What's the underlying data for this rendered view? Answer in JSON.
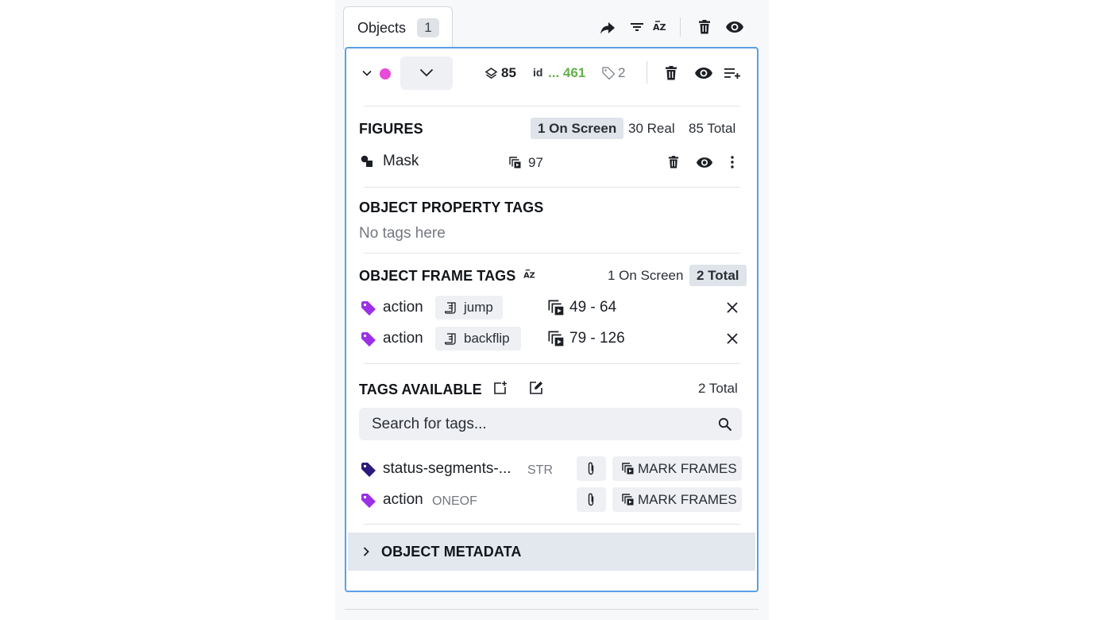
{
  "tab": {
    "label": "Objects",
    "count": "1"
  },
  "toolbar_icons": [
    "share-arrow-icon",
    "filter-icon",
    "sort-az-icon",
    "trash-icon",
    "eye-icon"
  ],
  "object": {
    "color": "#e64bd9",
    "layers_count": "85",
    "id_label": "id",
    "id_value": "... 461",
    "tags_count": "2"
  },
  "figures": {
    "heading": "FIGURES",
    "filters": [
      "1 On Screen",
      "30 Real",
      "85 Total"
    ],
    "active_filter": "1 On Screen",
    "item": {
      "name": "Mask",
      "frames": "97"
    }
  },
  "property_tags": {
    "heading": "OBJECT PROPERTY TAGS",
    "empty_text": "No tags here"
  },
  "frame_tags": {
    "heading": "OBJECT FRAME TAGS",
    "filters": [
      "1 On Screen",
      "2 Total"
    ],
    "active_filter": "2 Total",
    "rows": [
      {
        "name": "action",
        "value": "jump",
        "range": "49 - 64",
        "color": "#9b30e6"
      },
      {
        "name": "action",
        "value": "backflip",
        "range": "79 - 126",
        "color": "#9b30e6"
      }
    ]
  },
  "tags_available": {
    "heading": "TAGS AVAILABLE",
    "total": "2 Total",
    "search_placeholder": "Search for tags...",
    "items": [
      {
        "name": "status-segments-...",
        "type": "STR",
        "color": "#2b1b7c",
        "button": "MARK FRAMES"
      },
      {
        "name": "action",
        "type": "ONEOF",
        "color": "#9b30e6",
        "button": "MARK FRAMES"
      }
    ]
  },
  "metadata": {
    "heading": "OBJECT METADATA"
  }
}
